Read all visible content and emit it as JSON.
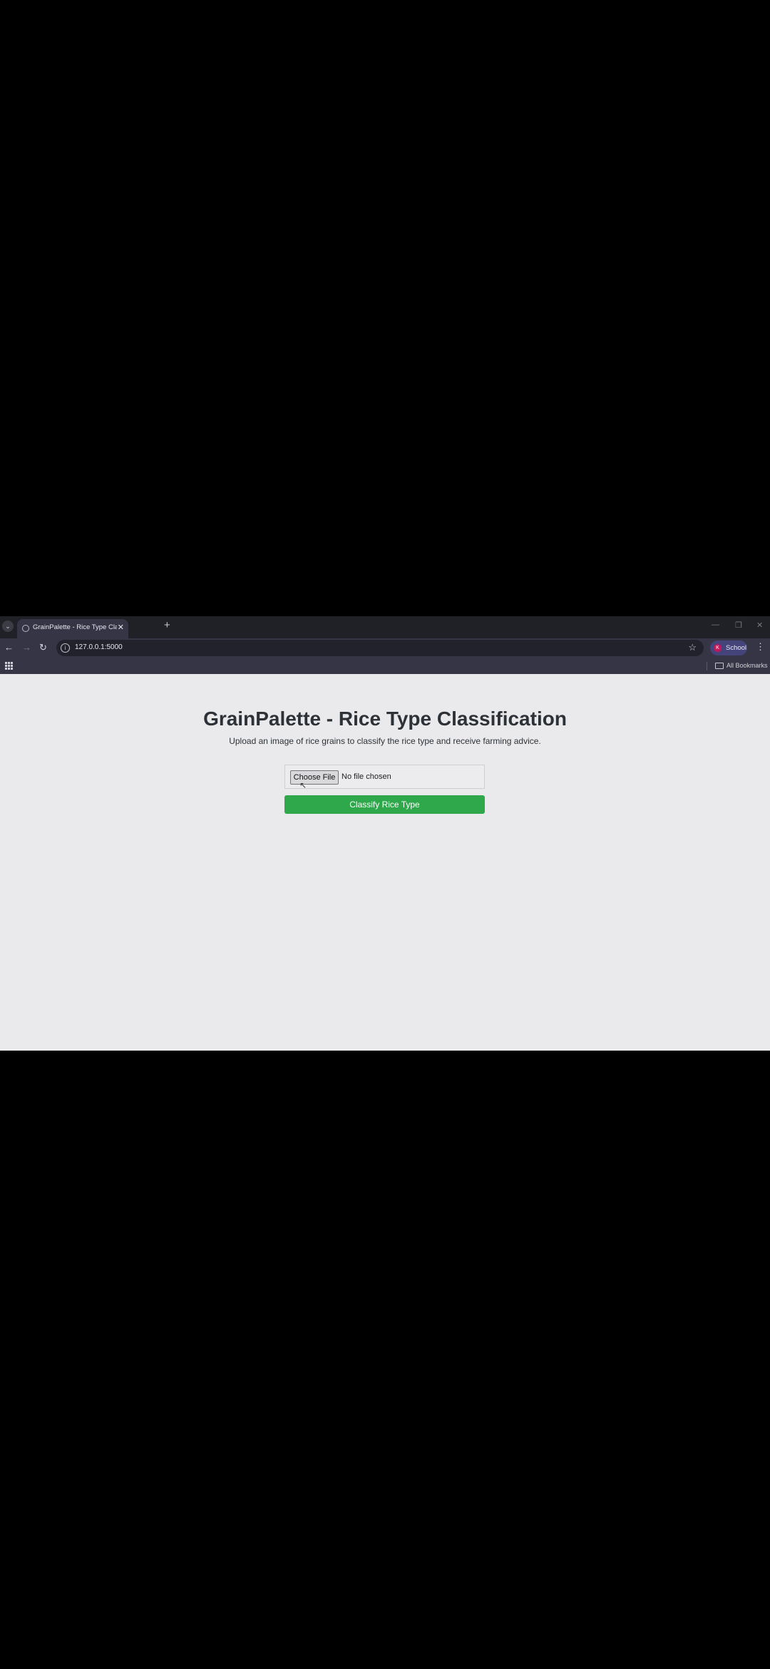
{
  "browser": {
    "tab_title": "GrainPalette - Rice Type Classifi",
    "url": "127.0.0.1:5000",
    "profile_initial": "K",
    "profile_label": "School",
    "bookmarks_label": "All Bookmarks"
  },
  "page": {
    "title": "GrainPalette - Rice Type Classification",
    "subtitle": "Upload an image of rice grains to classify the rice type and receive farming advice.",
    "choose_file_label": "Choose File",
    "file_status": "No file chosen",
    "submit_label": "Classify Rice Type"
  },
  "colors": {
    "accent": "#2ea84a",
    "page_background": "#eaeaec",
    "browser_chrome": "#353545",
    "title_text": "#2d3238"
  },
  "icons": [
    "tab-search-icon",
    "globe-icon",
    "close-icon",
    "plus-icon",
    "back-icon",
    "forward-icon",
    "reload-icon",
    "site-info-icon",
    "star-icon",
    "kebab-menu-icon",
    "apps-grid-icon",
    "folder-icon",
    "cursor-icon"
  ]
}
